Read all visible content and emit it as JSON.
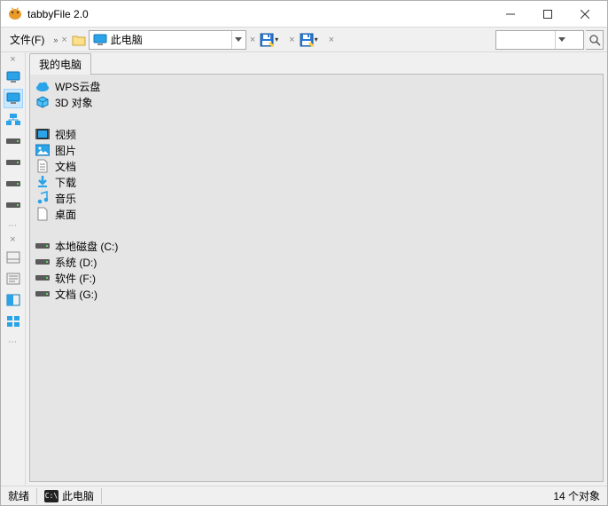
{
  "window": {
    "title": "tabbyFile 2.0"
  },
  "menu": {
    "file": "文件(F)"
  },
  "pathbar": {
    "current": "此电脑"
  },
  "tabs": [
    {
      "label": "我的电脑"
    }
  ],
  "files": [
    {
      "label": "WPS云盘",
      "icon": "cloud"
    },
    {
      "label": "3D 对象",
      "icon": "cube"
    },
    {
      "label": "视频",
      "icon": "video"
    },
    {
      "label": "图片",
      "icon": "picture"
    },
    {
      "label": "文档",
      "icon": "doc"
    },
    {
      "label": "下载",
      "icon": "download"
    },
    {
      "label": "音乐",
      "icon": "music"
    },
    {
      "label": "桌面",
      "icon": "desktop"
    },
    {
      "label": "本地磁盘 (C:)",
      "icon": "drive"
    },
    {
      "label": "系统 (D:)",
      "icon": "drive"
    },
    {
      "label": "软件 (F:)",
      "icon": "drive"
    },
    {
      "label": "文档 (G:)",
      "icon": "drive"
    }
  ],
  "status": {
    "ready": "就绪",
    "loc": "此电脑",
    "count": "14 个对象"
  }
}
